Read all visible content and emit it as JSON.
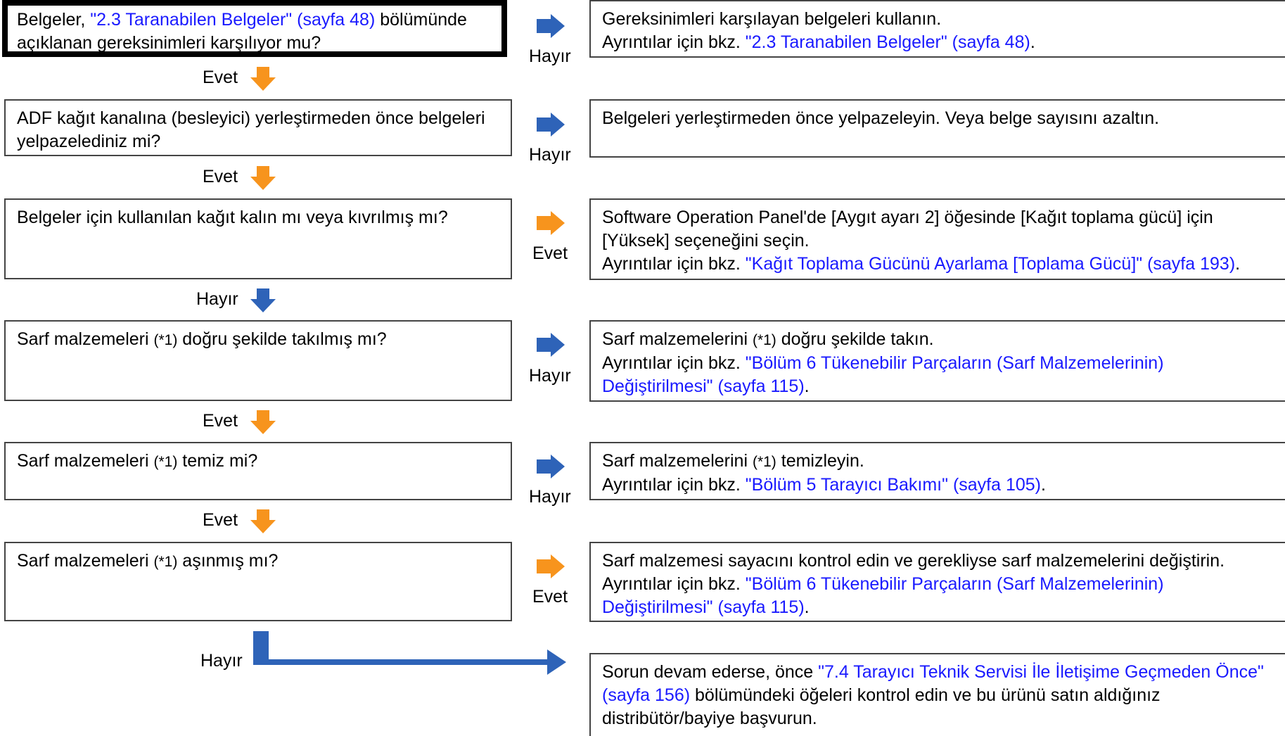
{
  "colors": {
    "blue": "#2e63b8",
    "orange": "#f7941d",
    "link": "#1a1aff"
  },
  "questions": [
    {
      "pre": "Belgeler, ",
      "link": "\"2.3 Taranabilen Belgeler\" (sayfa 48)",
      "post": " bölümünde açıklanan gereksinimleri karşılıyor mu?"
    },
    {
      "text": "ADF kağıt kanalına (besleyici) yerleştirmeden önce belgeleri yelpazelediniz mi?"
    },
    {
      "text": "Belgeler için kullanılan kağıt kalın mı veya kıvrılmış mı?"
    },
    {
      "pre": "Sarf malzemeleri ",
      "code": "(*1)",
      "post": " doğru şekilde takılmış mı?"
    },
    {
      "pre": "Sarf malzemeleri ",
      "code": "(*1)",
      "post": " temiz mi?"
    },
    {
      "pre": "Sarf malzemeleri ",
      "code": "(*1)",
      "post": " aşınmış mı?"
    }
  ],
  "answers": [
    {
      "line1": "Gereksinimleri karşılayan belgeleri kullanın.",
      "pre2": "Ayrıntılar için bkz. ",
      "link": "\"2.3 Taranabilen Belgeler\" (sayfa 48)",
      "post": "."
    },
    {
      "line1": "Belgeleri yerleştirmeden önce yelpazeleyin. Veya belge sayısını azaltın."
    },
    {
      "line1": "Software Operation Panel'de [Aygıt ayarı 2] öğesinde [Kağıt toplama gücü] için [Yüksek] seçeneğini seçin.",
      "pre2": "Ayrıntılar için bkz. ",
      "link": "\"Kağıt Toplama Gücünü Ayarlama [Toplama Gücü]\" (sayfa 193)",
      "post": "."
    },
    {
      "l1pre": "Sarf malzemelerini ",
      "l1code": "(*1)",
      "l1post": " doğru şekilde takın.",
      "pre2": "Ayrıntılar için bkz. ",
      "link": "\"Bölüm 6 Tükenebilir Parçaların (Sarf Malzemelerinin) Değiştirilmesi\" (sayfa 115)",
      "post": "."
    },
    {
      "l1pre": "Sarf malzemelerini ",
      "l1code": "(*1)",
      "l1post": " temizleyin.",
      "pre2": "Ayrıntılar için bkz. ",
      "link": "\"Bölüm 5 Tarayıcı Bakımı\" (sayfa 105)",
      "post": "."
    },
    {
      "line1": "Sarf malzemesi sayacını kontrol edin ve gerekliyse sarf malzemelerini değiştirin.",
      "pre2": "Ayrıntılar için bkz. ",
      "link": "\"Bölüm 6 Tükenebilir Parçaların (Sarf Malzemelerinin) Değiştirilmesi\" (sayfa 115)",
      "post": "."
    },
    {
      "pre": "Sorun devam ederse, önce ",
      "link": "\"7.4 Tarayıcı Teknik Servisi İle İletişime Geçmeden Önce\" (sayfa 156)",
      "post": " bölümündeki öğeleri kontrol edin ve bu ürünü satın aldığınız distribütör/bayiye başvurun."
    }
  ],
  "side_labels": [
    "Hayır",
    "Hayır",
    "Evet",
    "Hayır",
    "Hayır",
    "Evet"
  ],
  "down_labels": [
    "Evet",
    "Evet",
    "Hayır",
    "Evet",
    "Evet"
  ],
  "final_label": "Hayır"
}
